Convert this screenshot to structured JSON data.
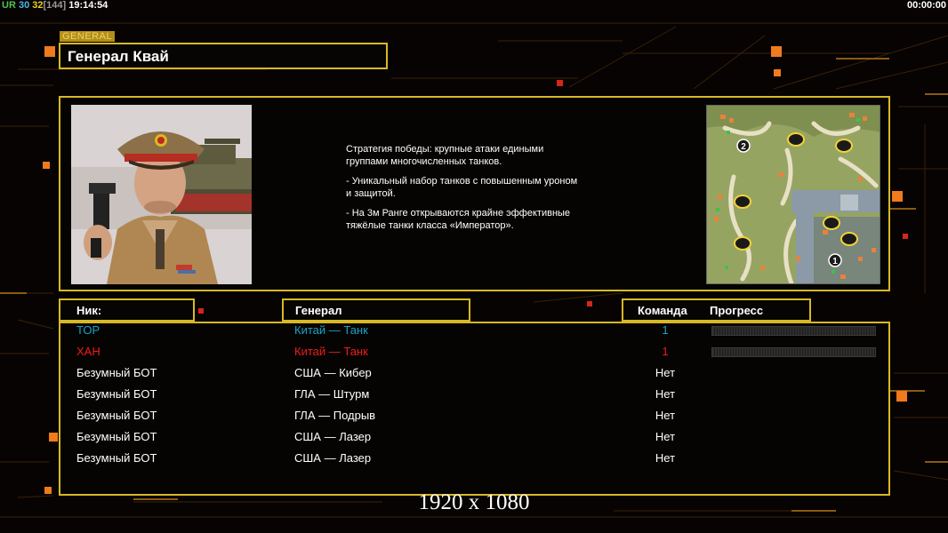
{
  "hud": {
    "ur": "UR",
    "n1": "30",
    "n2": "32",
    "n3": "[144]",
    "clock": "19:14:54",
    "timer": "00:00:00"
  },
  "colors": {
    "gold": "#d8b826",
    "orange": "#f07a1e",
    "cyan": "#18a3c8",
    "red": "#ef1b1b"
  },
  "general_panel": {
    "tag": "GENERAL",
    "name": "Генерал Квай",
    "description": [
      "Стратегия победы: крупные атаки едиными\n группами многочисленных танков.",
      "- Уникальный набор танков с повышенным уроном\n и защитой.",
      "- На 3м Ранге открываются крайне эффективные\n тяжёлые танки класса «Император»."
    ],
    "minimap": {
      "markers": [
        "2",
        "1"
      ]
    }
  },
  "player_table": {
    "headers": {
      "nick": "Ник:",
      "general": "Генерал",
      "team": "Команда",
      "progress": "Прогресс"
    },
    "rows": [
      {
        "nick": "ТОР",
        "general": "Китай — Танк",
        "team": "1",
        "color": "#18a3c8",
        "progress": true
      },
      {
        "nick": "ХАН",
        "general": "Китай — Танк",
        "team": "1",
        "color": "#ef1b1b",
        "progress": true
      },
      {
        "nick": "Безумный БОТ",
        "general": "США — Кибер",
        "team": "Нет",
        "color": "#ffffff",
        "progress": false
      },
      {
        "nick": "Безумный БОТ",
        "general": "ГЛА — Штурм",
        "team": "Нет",
        "color": "#ffffff",
        "progress": false
      },
      {
        "nick": "Безумный БОТ",
        "general": "ГЛА — Подрыв",
        "team": "Нет",
        "color": "#ffffff",
        "progress": false
      },
      {
        "nick": "Безумный БОТ",
        "general": "США — Лазер",
        "team": "Нет",
        "color": "#ffffff",
        "progress": false
      },
      {
        "nick": "Безумный БОТ",
        "general": "США — Лазер",
        "team": "Нет",
        "color": "#ffffff",
        "progress": false
      }
    ]
  },
  "watermark": "1920 x 1080"
}
